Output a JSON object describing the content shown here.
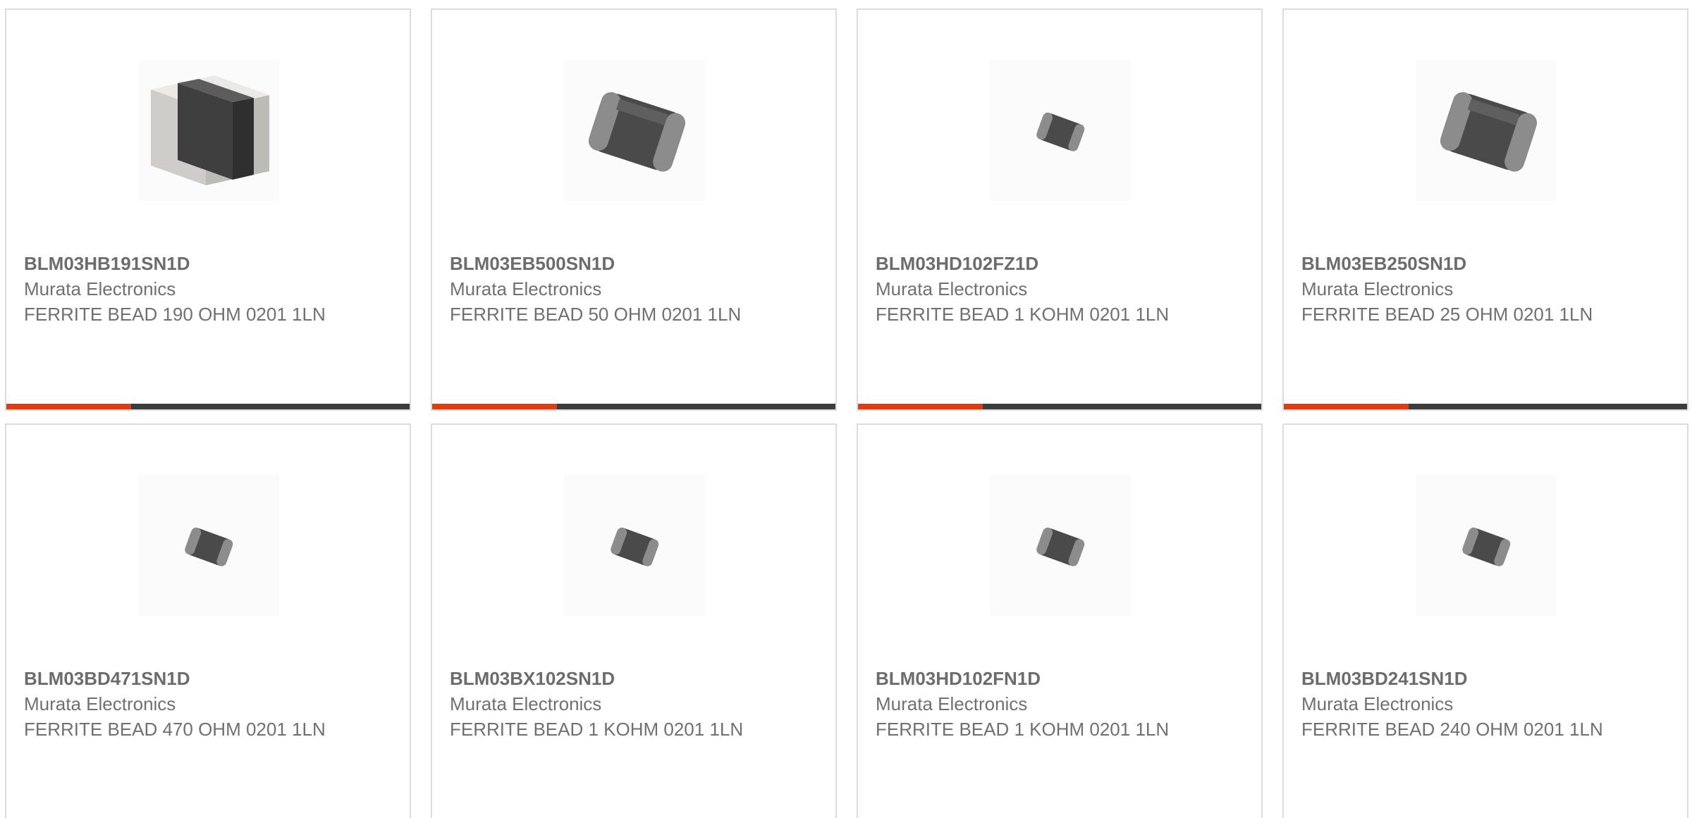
{
  "products": [
    {
      "part": "BLM03HB191SN1D",
      "manufacturer": "Murata Electronics",
      "description": "FERRITE BEAD 190 OHM 0201 1LN",
      "image": "ferrite-bead-large-block"
    },
    {
      "part": "BLM03EB500SN1D",
      "manufacturer": "Murata Electronics",
      "description": "FERRITE BEAD 50 OHM 0201 1LN",
      "image": "ferrite-bead-medium"
    },
    {
      "part": "BLM03HD102FZ1D",
      "manufacturer": "Murata Electronics",
      "description": "FERRITE BEAD 1 KOHM 0201 1LN",
      "image": "ferrite-bead-small"
    },
    {
      "part": "BLM03EB250SN1D",
      "manufacturer": "Murata Electronics",
      "description": "FERRITE BEAD 25 OHM 0201 1LN",
      "image": "ferrite-bead-medium"
    },
    {
      "part": "BLM03BD471SN1D",
      "manufacturer": "Murata Electronics",
      "description": "FERRITE BEAD 470 OHM 0201 1LN",
      "image": "ferrite-bead-small"
    },
    {
      "part": "BLM03BX102SN1D",
      "manufacturer": "Murata Electronics",
      "description": "FERRITE BEAD 1 KOHM 0201 1LN",
      "image": "ferrite-bead-small"
    },
    {
      "part": "BLM03HD102FN1D",
      "manufacturer": "Murata Electronics",
      "description": "FERRITE BEAD 1 KOHM 0201 1LN",
      "image": "ferrite-bead-small"
    },
    {
      "part": "BLM03BD241SN1D",
      "manufacturer": "Murata Electronics",
      "description": "FERRITE BEAD 240 OHM 0201 1LN",
      "image": "ferrite-bead-small"
    }
  ],
  "hover_bar": {
    "fill_fraction": 0.31
  },
  "colors": {
    "accent": "#e23b10",
    "bar_track": "#3c3c3c",
    "card_border": "#dcdcdc",
    "text": "#6c6c6c"
  }
}
